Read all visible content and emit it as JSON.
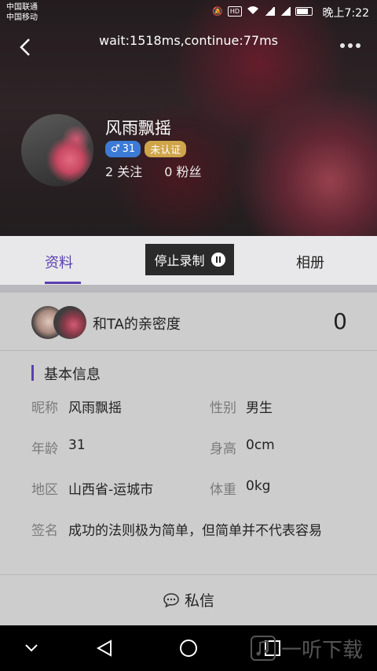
{
  "status_bar": {
    "carrier_1": "中国联通",
    "carrier_2": "中国移动",
    "time": "晚上7:22"
  },
  "header": {
    "debug_text": "wait:1518ms,continue:77ms"
  },
  "profile": {
    "nickname": "风雨飘摇",
    "gender_symbol": "♂",
    "age_badge": "31",
    "verify_badge": "未认证",
    "following": "2 关注",
    "followers": "0 粉丝"
  },
  "tabs": {
    "items": [
      {
        "label": "资料",
        "active": true
      },
      {
        "label": "相册",
        "active": false
      }
    ]
  },
  "recording": {
    "label": "停止录制"
  },
  "intimacy": {
    "label": "和TA的亲密度",
    "value": "0"
  },
  "basic_info": {
    "title": "基本信息",
    "nickname_label": "昵称",
    "nickname_value": "风雨飘摇",
    "gender_label": "性别",
    "gender_value": "男生",
    "age_label": "年龄",
    "age_value": "31",
    "height_label": "身高",
    "height_value": "0cm",
    "region_label": "地区",
    "region_value": "山西省-运城市",
    "weight_label": "体重",
    "weight_value": "0kg",
    "signature_label": "签名",
    "signature_value": "成功的法则极为简单，但简单并不代表容易"
  },
  "actions": {
    "message_label": "私信"
  },
  "watermark": {
    "text": "一听下载"
  },
  "colors": {
    "accent": "#5b3fb0",
    "gender_badge": "#3b7bd6",
    "verify_badge": "#cfa54a"
  }
}
